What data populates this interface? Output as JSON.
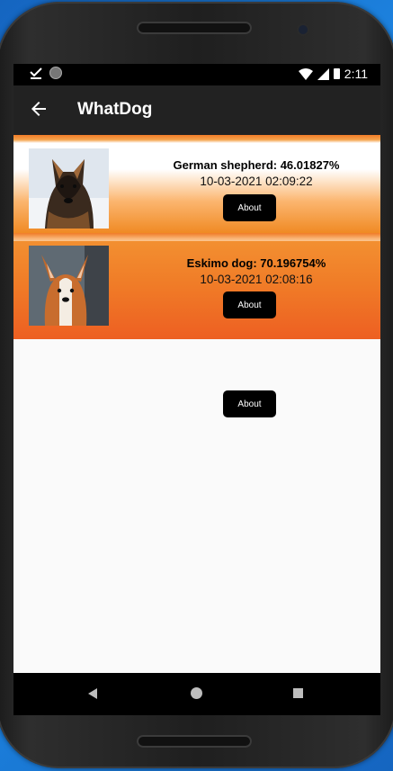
{
  "status_bar": {
    "icons": [
      "check-download-icon",
      "circle-icon",
      "wifi-icon",
      "cell-signal-icon",
      "battery-icon"
    ],
    "time": "2:11"
  },
  "app_bar": {
    "back_icon": "arrow-left-icon",
    "title": "WhatDog"
  },
  "results": [
    {
      "image": "german-shepherd-photo",
      "prediction": "German shepherd: 46.01827%",
      "timestamp": "10-03-2021 02:09:22",
      "about_label": "About"
    },
    {
      "image": "corgi-photo",
      "prediction": "Eskimo dog: 70.196754%",
      "timestamp": "10-03-2021 02:08:16",
      "about_label": "About"
    }
  ],
  "extra_button": {
    "label": "About"
  },
  "colors": {
    "accent_orange": "#f07b27",
    "app_bar": "#222222",
    "button": "#000000"
  }
}
